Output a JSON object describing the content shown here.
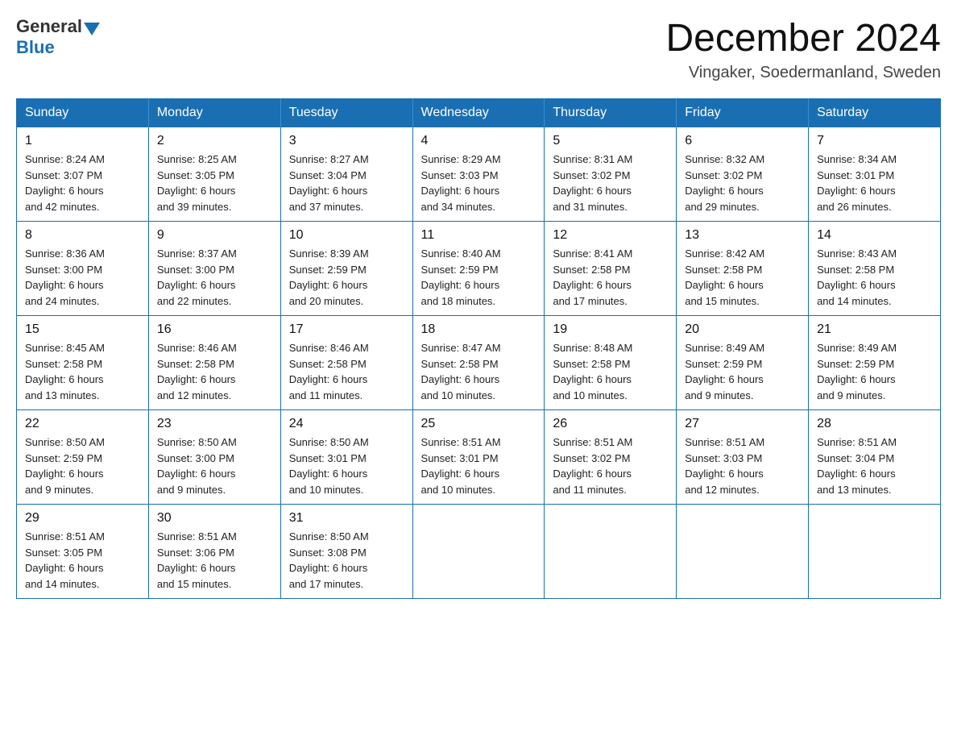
{
  "header": {
    "logo": {
      "general": "General",
      "blue": "Blue"
    },
    "title": "December 2024",
    "location": "Vingaker, Soedermanland, Sweden"
  },
  "days_of_week": [
    "Sunday",
    "Monday",
    "Tuesday",
    "Wednesday",
    "Thursday",
    "Friday",
    "Saturday"
  ],
  "weeks": [
    [
      {
        "day": "1",
        "sunrise": "8:24 AM",
        "sunset": "3:07 PM",
        "daylight": "6 hours and 42 minutes."
      },
      {
        "day": "2",
        "sunrise": "8:25 AM",
        "sunset": "3:05 PM",
        "daylight": "6 hours and 39 minutes."
      },
      {
        "day": "3",
        "sunrise": "8:27 AM",
        "sunset": "3:04 PM",
        "daylight": "6 hours and 37 minutes."
      },
      {
        "day": "4",
        "sunrise": "8:29 AM",
        "sunset": "3:03 PM",
        "daylight": "6 hours and 34 minutes."
      },
      {
        "day": "5",
        "sunrise": "8:31 AM",
        "sunset": "3:02 PM",
        "daylight": "6 hours and 31 minutes."
      },
      {
        "day": "6",
        "sunrise": "8:32 AM",
        "sunset": "3:02 PM",
        "daylight": "6 hours and 29 minutes."
      },
      {
        "day": "7",
        "sunrise": "8:34 AM",
        "sunset": "3:01 PM",
        "daylight": "6 hours and 26 minutes."
      }
    ],
    [
      {
        "day": "8",
        "sunrise": "8:36 AM",
        "sunset": "3:00 PM",
        "daylight": "6 hours and 24 minutes."
      },
      {
        "day": "9",
        "sunrise": "8:37 AM",
        "sunset": "3:00 PM",
        "daylight": "6 hours and 22 minutes."
      },
      {
        "day": "10",
        "sunrise": "8:39 AM",
        "sunset": "2:59 PM",
        "daylight": "6 hours and 20 minutes."
      },
      {
        "day": "11",
        "sunrise": "8:40 AM",
        "sunset": "2:59 PM",
        "daylight": "6 hours and 18 minutes."
      },
      {
        "day": "12",
        "sunrise": "8:41 AM",
        "sunset": "2:58 PM",
        "daylight": "6 hours and 17 minutes."
      },
      {
        "day": "13",
        "sunrise": "8:42 AM",
        "sunset": "2:58 PM",
        "daylight": "6 hours and 15 minutes."
      },
      {
        "day": "14",
        "sunrise": "8:43 AM",
        "sunset": "2:58 PM",
        "daylight": "6 hours and 14 minutes."
      }
    ],
    [
      {
        "day": "15",
        "sunrise": "8:45 AM",
        "sunset": "2:58 PM",
        "daylight": "6 hours and 13 minutes."
      },
      {
        "day": "16",
        "sunrise": "8:46 AM",
        "sunset": "2:58 PM",
        "daylight": "6 hours and 12 minutes."
      },
      {
        "day": "17",
        "sunrise": "8:46 AM",
        "sunset": "2:58 PM",
        "daylight": "6 hours and 11 minutes."
      },
      {
        "day": "18",
        "sunrise": "8:47 AM",
        "sunset": "2:58 PM",
        "daylight": "6 hours and 10 minutes."
      },
      {
        "day": "19",
        "sunrise": "8:48 AM",
        "sunset": "2:58 PM",
        "daylight": "6 hours and 10 minutes."
      },
      {
        "day": "20",
        "sunrise": "8:49 AM",
        "sunset": "2:59 PM",
        "daylight": "6 hours and 9 minutes."
      },
      {
        "day": "21",
        "sunrise": "8:49 AM",
        "sunset": "2:59 PM",
        "daylight": "6 hours and 9 minutes."
      }
    ],
    [
      {
        "day": "22",
        "sunrise": "8:50 AM",
        "sunset": "2:59 PM",
        "daylight": "6 hours and 9 minutes."
      },
      {
        "day": "23",
        "sunrise": "8:50 AM",
        "sunset": "3:00 PM",
        "daylight": "6 hours and 9 minutes."
      },
      {
        "day": "24",
        "sunrise": "8:50 AM",
        "sunset": "3:01 PM",
        "daylight": "6 hours and 10 minutes."
      },
      {
        "day": "25",
        "sunrise": "8:51 AM",
        "sunset": "3:01 PM",
        "daylight": "6 hours and 10 minutes."
      },
      {
        "day": "26",
        "sunrise": "8:51 AM",
        "sunset": "3:02 PM",
        "daylight": "6 hours and 11 minutes."
      },
      {
        "day": "27",
        "sunrise": "8:51 AM",
        "sunset": "3:03 PM",
        "daylight": "6 hours and 12 minutes."
      },
      {
        "day": "28",
        "sunrise": "8:51 AM",
        "sunset": "3:04 PM",
        "daylight": "6 hours and 13 minutes."
      }
    ],
    [
      {
        "day": "29",
        "sunrise": "8:51 AM",
        "sunset": "3:05 PM",
        "daylight": "6 hours and 14 minutes."
      },
      {
        "day": "30",
        "sunrise": "8:51 AM",
        "sunset": "3:06 PM",
        "daylight": "6 hours and 15 minutes."
      },
      {
        "day": "31",
        "sunrise": "8:50 AM",
        "sunset": "3:08 PM",
        "daylight": "6 hours and 17 minutes."
      },
      null,
      null,
      null,
      null
    ]
  ],
  "labels": {
    "sunrise": "Sunrise:",
    "sunset": "Sunset:",
    "daylight": "Daylight:"
  }
}
